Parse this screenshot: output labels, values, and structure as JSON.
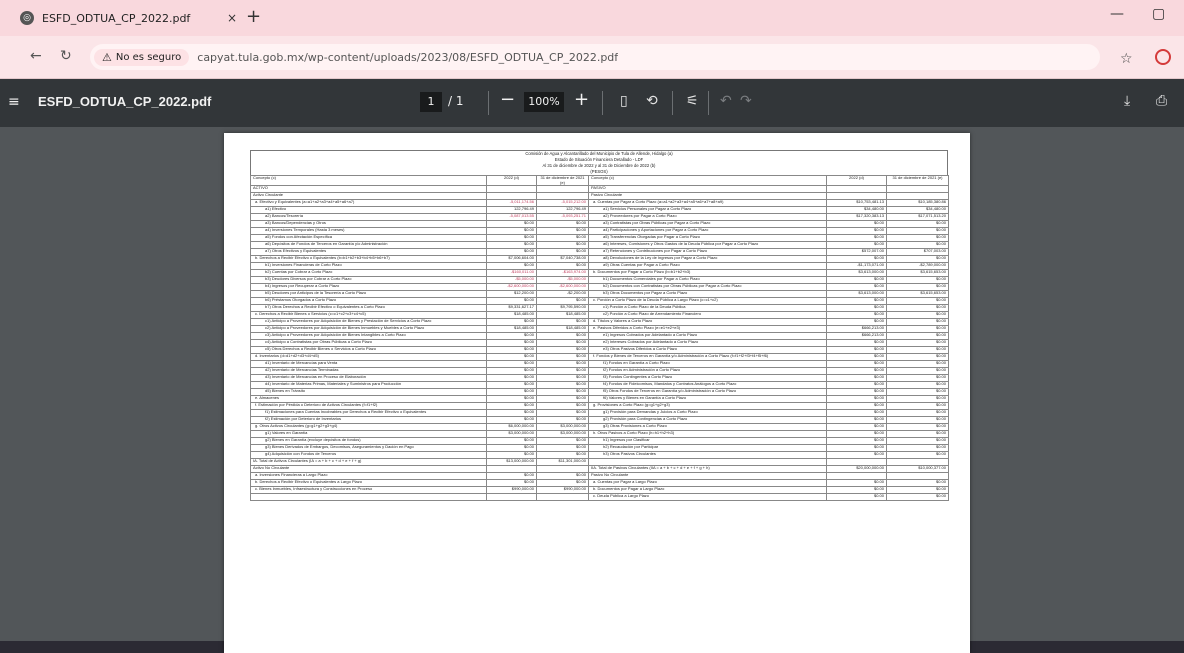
{
  "tab": {
    "title": "ESFD_ODTUA_CP_2022.pdf",
    "close": "×",
    "new": "+"
  },
  "window": {
    "minimize": "—",
    "restore": "▢"
  },
  "address": {
    "security_label": "No es seguro",
    "url": "capyat.tula.gob.mx/wp-content/uploads/2023/08/ESFD_ODTUA_CP_2022.pdf"
  },
  "pdf_toolbar": {
    "title": "ESFD_ODTUA_CP_2022.pdf",
    "page_current": "1",
    "page_total": "/ 1",
    "zoom": "100%"
  },
  "icons": {
    "menu": "≡",
    "back": "←",
    "reload": "↻",
    "warn": "⚠",
    "star": "☆",
    "fit": "▯",
    "rotate": "⟲",
    "thumb": "⚟",
    "undo": "↶",
    "redo": "↷",
    "download": "⤓",
    "print": "⎙",
    "minus": "−",
    "plus": "+"
  },
  "doc": {
    "heading": [
      "Comisión de Agua y Alcantarillado del Municipio de Tula de Allende, Hidalgo (a)",
      "Estado de Situación Financiera Detallado - LDF",
      "Al 31 de diciembre de 2022 y al 31 de Diciembre de 2022 (b)",
      "(PESOS)"
    ],
    "col_concepto": "Concepto (c)",
    "col_2022": "2022 (d)",
    "col_prev": "31 de diciembre de 2021 (e)",
    "left_rows": [
      [
        "ACTIVO",
        "",
        "",
        ""
      ],
      [
        "Activo Circulante",
        "",
        "",
        ""
      ],
      [
        "a. Efectivo y Equivalentes (a=a1+a2+a3+a4+a5+a6+a7)",
        "-5,011,174.56",
        "-5,015,212.00",
        "red"
      ],
      [
        "a1) Efectivo",
        "122,796.49",
        "122,796.49",
        ""
      ],
      [
        "a2) Bancos/Tesorería",
        "-5,087,013.55",
        "-5,093,251.71",
        "red"
      ],
      [
        "a3) Bancos/Dependencias y Otros",
        "$0.00",
        "$0.00",
        ""
      ],
      [
        "a4) Inversiones Temporales (Hasta 3 meses)",
        "$0.00",
        "$0.00",
        ""
      ],
      [
        "a5) Fondos con Afectación Específica",
        "$0.00",
        "$0.00",
        ""
      ],
      [
        "a6) Depósitos de Fondos de Terceros en Garantía y/o Administración",
        "$0.00",
        "$0.00",
        ""
      ],
      [
        "a7) Otros Efectivos y Equivalentes",
        "$0.00",
        "$0.00",
        ""
      ],
      [
        "b. Derechos a Recibir Efectivo o Equivalentes (b=b1+b2+b3+b4+b5+b6+b7)",
        "$7,006,604.00",
        "$7,040,738.00",
        ""
      ],
      [
        "b1) Inversiones Financieras de Corto Plazo",
        "$0.00",
        "$0.00",
        ""
      ],
      [
        "b2) Cuentas por Cobrar a Corto Plazo",
        "-$160,011.00",
        "-$163,974.00",
        "red"
      ],
      [
        "b3) Deudores Diversos por Cobrar a Corto Plazo",
        "-$5,000.00",
        "-$5,000.00",
        "red"
      ],
      [
        "b4) Ingresos por Recuperar a Corto Plazo",
        "-$2,600,000.00",
        "-$2,600,000.00",
        "red"
      ],
      [
        "b5) Deudores por Anticipos de la Tesorería a Corto Plazo",
        "$12,200.00",
        "-$2,200.00",
        ""
      ],
      [
        "b6) Préstamos Otorgados a Corto Plazo",
        "$0.00",
        "$0.00",
        ""
      ],
      [
        "b7) Otros Derechos a Recibir Efectivo o Equivalentes a Corto Plazo",
        "$9,331,627.17",
        "$9,795,590.00",
        ""
      ],
      [
        "c. Derechos a Recibir Bienes o Servicios (c=c1+c2+c3+c4+c5)",
        "$18,485.00",
        "$18,485.00",
        ""
      ],
      [
        "c1) Anticipo a Proveedores por Adquisición de Bienes y Prestación de Servicios a Corto Plazo",
        "$0.00",
        "$0.00",
        ""
      ],
      [
        "c2) Anticipo a Proveedores por Adquisición de Bienes Inmuebles y Muebles a Corto Plazo",
        "$18,485.00",
        "$18,485.00",
        ""
      ],
      [
        "c3) Anticipo a Proveedores por Adquisición de Bienes Intangibles a Corto Plazo",
        "$0.00",
        "$0.00",
        ""
      ],
      [
        "c4) Anticipo a Contratistas por Obras Públicas a Corto Plazo",
        "$0.00",
        "$0.00",
        ""
      ],
      [
        "c5) Otros Derechos a Recibir Bienes o Servicios a Corto Plazo",
        "$0.00",
        "$0.00",
        ""
      ],
      [
        "d. Inventarios (d=d1+d2+d3+d4+d5)",
        "$0.00",
        "$0.00",
        ""
      ],
      [
        "d1) Inventario de Mercancías para Venta",
        "$0.00",
        "$0.00",
        ""
      ],
      [
        "d2) Inventario de Mercancías Terminadas",
        "$0.00",
        "$0.00",
        ""
      ],
      [
        "d3) Inventario de Mercancías en Proceso de Elaboración",
        "$0.00",
        "$0.00",
        ""
      ],
      [
        "d4) Inventario de Materias Primas, Materiales y Suministros para Producción",
        "$0.00",
        "$0.00",
        ""
      ],
      [
        "d5) Bienes en Tránsito",
        "$0.00",
        "$0.00",
        ""
      ],
      [
        "e. Almacenes",
        "$0.00",
        "$0.00",
        ""
      ],
      [
        "f. Estimación por Pérdida o Deterioro de Activos Circulantes (f=f1+f2)",
        "$0.00",
        "$0.00",
        ""
      ],
      [
        "f1) Estimaciones para Cuentas Incobrables por Derechos a Recibir Efectivo o Equivalentes",
        "$0.00",
        "$0.00",
        ""
      ],
      [
        "f2) Estimación por Deterioro de Inventarios",
        "$0.00",
        "$0.00",
        ""
      ],
      [
        "g. Otros Activos Circulantes (g=g1+g2+g3+g4)",
        "$6,000,000.00",
        "$3,000,000.00",
        ""
      ],
      [
        "g1) Valores en Garantía",
        "$3,000,000.00",
        "$3,000,000.00",
        ""
      ],
      [
        "g2) Bienes en Garantía (excluye depósitos de fondos)",
        "$0.00",
        "$0.00",
        ""
      ],
      [
        "g3) Bienes Derivados de Embargos, Decomisos, Aseguramientos y Dación en Pago",
        "$0.00",
        "$0.00",
        ""
      ],
      [
        "g4) Adquisición con Fondos de Terceros",
        "$0.00",
        "$0.00",
        ""
      ],
      [
        "IA. Total de Activos Circulantes (IA = a + b + c + d + e + f + g)",
        "$13,000,000.00",
        "$11,301,000.00",
        ""
      ],
      [
        "Activo No Circulante",
        "",
        "",
        ""
      ],
      [
        "a. Inversiones Financieras a Largo Plazo",
        "$0.00",
        "$0.00",
        ""
      ],
      [
        "b. Derechos a Recibir Efectivo o Equivalentes a Largo Plazo",
        "$0.00",
        "$0.00",
        ""
      ],
      [
        "c. Bienes Inmuebles, Infraestructura y Construcciones en Proceso",
        "$990,000.00",
        "$990,000.00",
        ""
      ]
    ],
    "right_rows": [
      [
        "PASIVO",
        "",
        "",
        ""
      ],
      [
        "Pasivo Circulante",
        "",
        "",
        ""
      ],
      [
        "a. Cuentas por Pagar a Corto Plazo (a=a1+a2+a3+a4+a5+a6+a7+a8+a9)",
        "$10,753,481.13",
        "$10,185,380.86",
        ""
      ],
      [
        "a1) Servicios Personales por Pagar a Corto Plazo",
        "$34,480.00",
        "$34,480.00",
        ""
      ],
      [
        "a2) Proveedores por Pagar a Corto Plazo",
        "$17,320,383.13",
        "$17,071,513.20",
        ""
      ],
      [
        "a3) Contratistas por Obras Públicas por Pagar a Corto Plazo",
        "$0.00",
        "$0.00",
        ""
      ],
      [
        "a4) Participaciones y Aportaciones por Pagar a Corto Plazo",
        "$0.00",
        "$0.00",
        ""
      ],
      [
        "a5) Transferencias Otorgadas por Pagar a Corto Plazo",
        "$0.00",
        "$0.00",
        ""
      ],
      [
        "a6) Intereses, Comisiones y Otros Gastos de la Deuda Pública por Pagar a Corto Plazo",
        "$0.00",
        "$0.00",
        ""
      ],
      [
        "a7) Retenciones y Contribuciones por Pagar a Corto Plazo",
        "$572,007.00",
        "$707,003.00",
        ""
      ],
      [
        "a8) Devoluciones de la Ley de Ingresos por Pagar a Corto Plazo",
        "$0.00",
        "$0.00",
        ""
      ],
      [
        "a9) Otras Cuentas por Pagar a Corto Plazo",
        "-$1,173,071.00",
        "-$2,789,000.00",
        ""
      ],
      [
        "b. Documentos por Pagar a Corto Plazo (b=b1+b2+b3)",
        "$3,613,000.00",
        "$3,615,653.00",
        ""
      ],
      [
        "b1) Documentos Comerciales por Pagar a Corto Plazo",
        "$0.00",
        "$0.00",
        ""
      ],
      [
        "b2) Documentos con Contratistas por Obras Públicas por Pagar a Corto Plazo",
        "$0.00",
        "$0.00",
        ""
      ],
      [
        "b3) Otros Documentos por Pagar a Corto Plazo",
        "$3,613,000.00",
        "$3,615,653.00",
        ""
      ],
      [
        "c. Porción a Corto Plazo de la Deuda Pública a Largo Plazo (c=c1+c2)",
        "$0.00",
        "$0.00",
        ""
      ],
      [
        "c1) Porción a Corto Plazo de la Deuda Pública",
        "$0.00",
        "$0.00",
        ""
      ],
      [
        "c2) Porción a Corto Plazo de Arrendamiento Financiero",
        "$0.00",
        "$0.00",
        ""
      ],
      [
        "d. Títulos y Valores a Corto Plazo",
        "$0.00",
        "$0.00",
        ""
      ],
      [
        "e. Pasivos Diferidos a Corto Plazo (e=e1+e2+e3)",
        "$666,213.00",
        "$0.00",
        ""
      ],
      [
        "e1) Ingresos Cobrados por Adelantado a Corto Plazo",
        "$666,213.00",
        "$0.00",
        ""
      ],
      [
        "e2) Intereses Cobrados por Adelantado a Corto Plazo",
        "$0.00",
        "$0.00",
        ""
      ],
      [
        "e3) Otros Pasivos Diferidos a Corto Plazo",
        "$0.00",
        "$0.00",
        ""
      ],
      [
        "f. Fondos y Bienes de Terceros en Garantía y/o Administración a Corto Plazo (f=f1+f2+f3+f4+f5+f6)",
        "$0.00",
        "$0.00",
        ""
      ],
      [
        "f1) Fondos en Garantía a Corto Plazo",
        "$0.00",
        "$0.00",
        ""
      ],
      [
        "f2) Fondos en Administración a Corto Plazo",
        "$0.00",
        "$0.00",
        ""
      ],
      [
        "f3) Fondos Contingentes a Corto Plazo",
        "$0.00",
        "$0.00",
        ""
      ],
      [
        "f4) Fondos de Fideicomisos, Mandatos y Contratos Análogos a Corto Plazo",
        "$0.00",
        "$0.00",
        ""
      ],
      [
        "f5) Otros Fondos de Terceros en Garantía y/o Administración a Corto Plazo",
        "$0.00",
        "$0.00",
        ""
      ],
      [
        "f6) Valores y Bienes en Garantía a Corto Plazo",
        "$0.00",
        "$0.00",
        ""
      ],
      [
        "g. Provisiones a Corto Plazo (g=g1+g2+g3)",
        "$0.00",
        "$0.00",
        ""
      ],
      [
        "g1) Provisión para Demandas y Juicios a Corto Plazo",
        "$0.00",
        "$0.00",
        ""
      ],
      [
        "g2) Provisión para Contingencias a Corto Plazo",
        "$0.00",
        "$0.00",
        ""
      ],
      [
        "g3) Otras Provisiones a Corto Plazo",
        "$0.00",
        "$0.00",
        ""
      ],
      [
        "h. Otros Pasivos a Corto Plazo (h=h1+h2+h3)",
        "$0.00",
        "$0.00",
        ""
      ],
      [
        "h1) Ingresos por Clasificar",
        "$0.00",
        "$0.00",
        ""
      ],
      [
        "h2) Recaudación por Participar",
        "$0.00",
        "$0.00",
        ""
      ],
      [
        "h3) Otros Pasivos Circulantes",
        "$0.00",
        "$0.00",
        ""
      ],
      [
        "",
        "",
        "",
        ""
      ],
      [
        "IIA. Total de Pasivos Circulantes (IIA = a + b + c + d + e + f + g + h)",
        "$20,000,000.00",
        "$10,000,377.00",
        ""
      ],
      [
        "Pasivo No Circulante",
        "",
        "",
        ""
      ],
      [
        "a. Cuentas por Pagar a Largo Plazo",
        "$0.00",
        "$0.00",
        ""
      ],
      [
        "b. Documentos por Pagar a Largo Plazo",
        "$0.00",
        "$0.00",
        ""
      ],
      [
        "c. Deuda Pública a Largo Plazo",
        "$0.00",
        "$0.00",
        ""
      ]
    ]
  }
}
